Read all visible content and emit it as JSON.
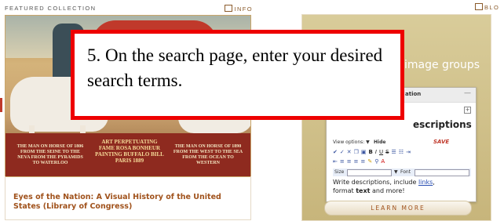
{
  "featured": {
    "label": "FEATURED COLLECTION",
    "info_label": "INFO",
    "poster_text_left": "THE MAN ON HORSE OF 1806 FROM THE SEINE TO THE NEVA FROM THE PYRAMIDS TO WATERLOO",
    "poster_text_center": "ART PERPETUATING FAME ROSA BONHEUR PAINTING BUFFALO BILL PARIS 1889",
    "poster_text_right": "THE MAN ON HORSE OF 1890 FROM THE WEST TO THE SEA FROM THE OCEAN TO WESTERN",
    "title": "Eyes of the Nation: A Visual History of the United States (Library of Congress)"
  },
  "blog": {
    "label": "BLO"
  },
  "promo": {
    "heading": "image groups",
    "editor_header": "ation",
    "editor_title": "escriptions",
    "view_options": "View options: ▼",
    "hide": "Hide",
    "save": "SAVE",
    "size_label": "Size",
    "font_label": "Font",
    "edit_text_1": "Write descriptions, include ",
    "edit_link": "links",
    "edit_text_2": ",",
    "edit_text_3": "format ",
    "edit_bold": "text",
    "edit_text_4": " and more!",
    "learn_more": "LEARN MORE"
  },
  "callout": {
    "text": "5. On the search page, enter your desired search terms."
  },
  "colors": {
    "callout_border": "#ee0000",
    "link_brown": "#a0521c"
  }
}
